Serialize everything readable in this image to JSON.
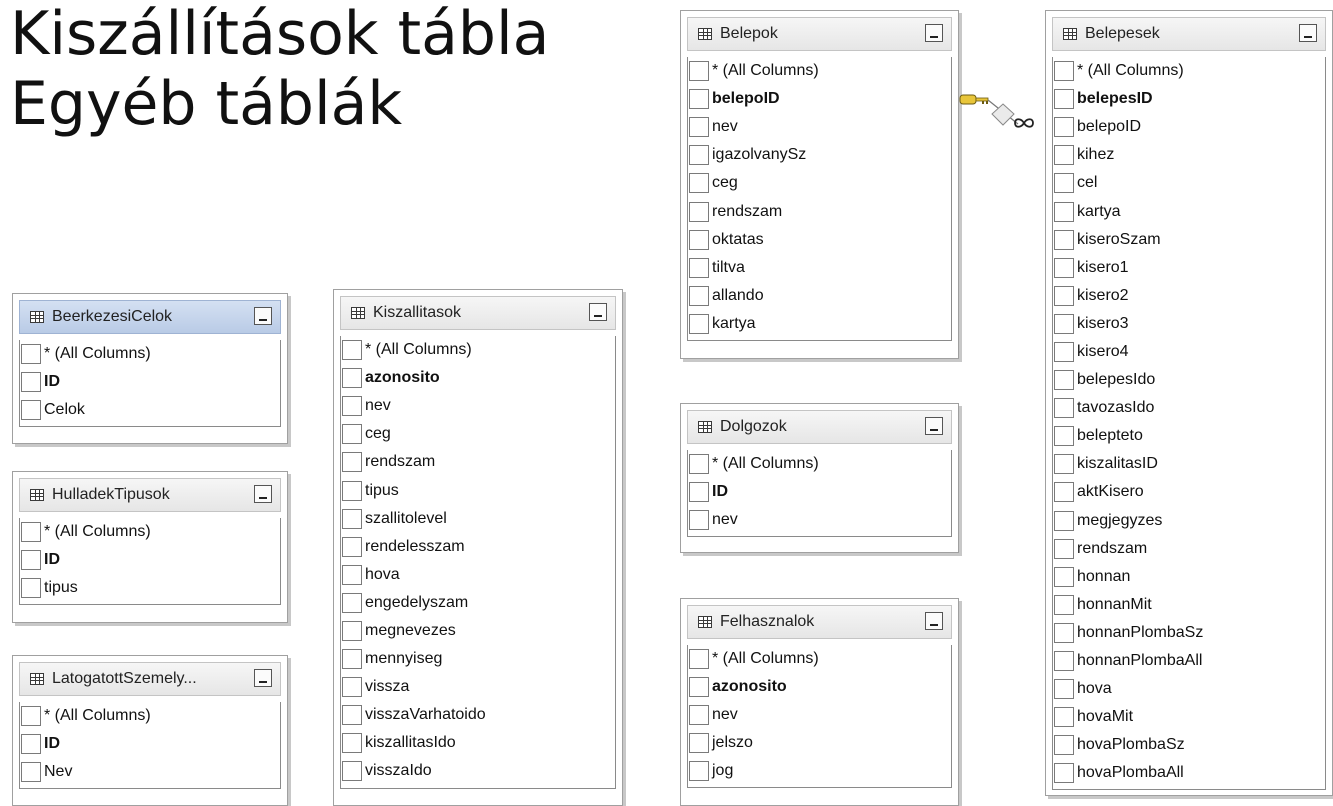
{
  "title": {
    "line1": "Kiszállítások tábla",
    "line2": "Egyéb táblák"
  },
  "icons": {
    "table": "table-grid-icon",
    "minimize": "minimize-icon",
    "relationship": "key-infinity-relationship-icon"
  },
  "tables": {
    "beerkezesi": {
      "name": "BeerkezesiCelok",
      "columns": [
        "* (All Columns)",
        "ID",
        "Celok"
      ]
    },
    "hulladek": {
      "name": "HulladekTipusok",
      "columns": [
        "* (All Columns)",
        "ID",
        "tipus"
      ]
    },
    "latogatott": {
      "name": "LatogatottSzemely...",
      "columns": [
        "* (All Columns)",
        "ID",
        "Nev"
      ]
    },
    "kiszallitasok": {
      "name": "Kiszallitasok",
      "columns": [
        "* (All Columns)",
        "azonosito",
        "nev",
        "ceg",
        "rendszam",
        "tipus",
        "szallitolevel",
        "rendelesszam",
        "hova",
        "engedelyszam",
        "megnevezes",
        "mennyiseg",
        "vissza",
        "visszaVarhatoido",
        "kiszallitasIdo",
        "visszaIdo"
      ]
    },
    "belepok": {
      "name": "Belepok",
      "columns": [
        "* (All Columns)",
        "belepoID",
        "nev",
        "igazolvanySz",
        "ceg",
        "rendszam",
        "oktatas",
        "tiltva",
        "allando",
        "kartya"
      ]
    },
    "dolgozok": {
      "name": "Dolgozok",
      "columns": [
        "* (All Columns)",
        "ID",
        "nev"
      ]
    },
    "felhasznalok": {
      "name": "Felhasznalok",
      "columns": [
        "* (All Columns)",
        "azonosito",
        "nev",
        "jelszo",
        "jog"
      ]
    },
    "belepesek": {
      "name": "Belepesek",
      "columns": [
        "* (All Columns)",
        "belepesID",
        "belepoID",
        "kihez",
        "cel",
        "kartya",
        "kiseroSzam",
        "kisero1",
        "kisero2",
        "kisero3",
        "kisero4",
        "belepesIdo",
        "tavozasIdo",
        "belepteto",
        "kiszalitasID",
        "aktKisero",
        "megjegyzes",
        "rendszam",
        "honnan",
        "honnanMit",
        "honnanPlombaSz",
        "honnanPlombaAll",
        "hova",
        "hovaMit",
        "hovaPlombaSz",
        "hovaPlombaAll"
      ]
    }
  }
}
